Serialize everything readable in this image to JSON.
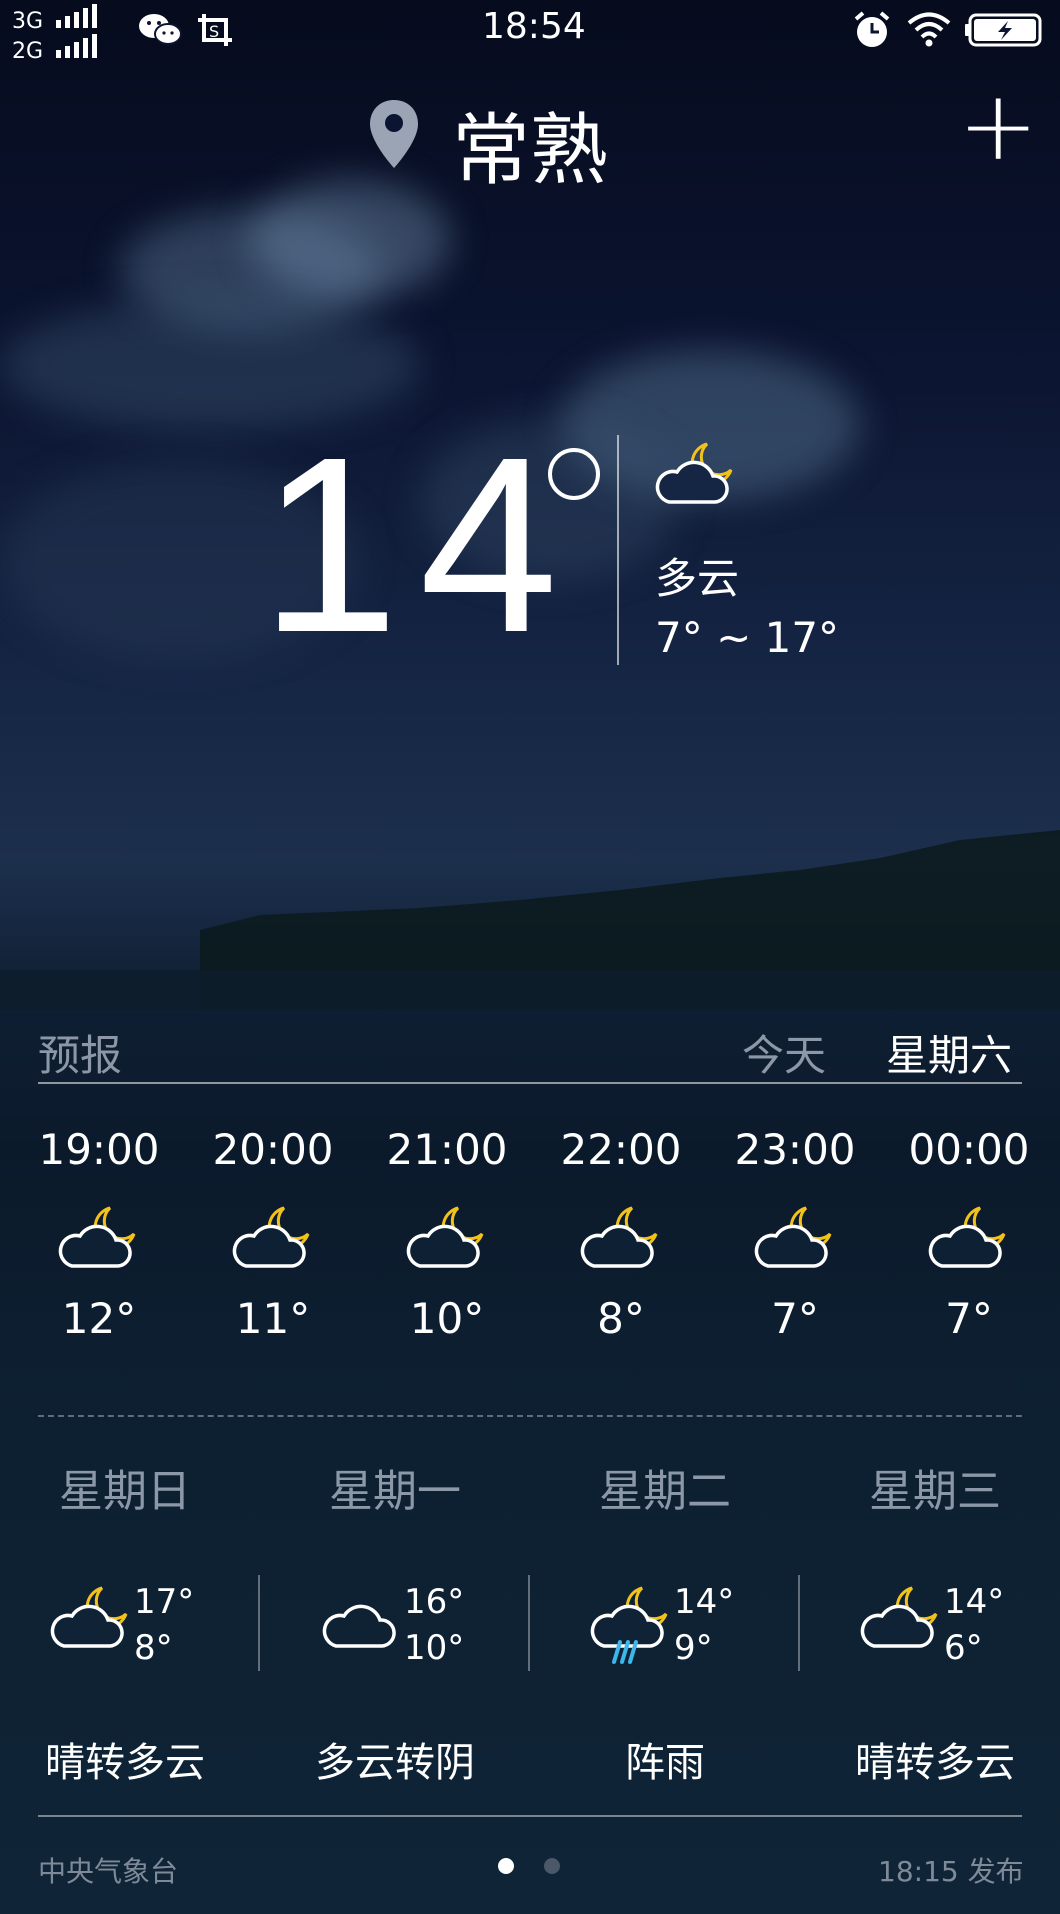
{
  "status_bar": {
    "network_1": "3G",
    "network_2": "2G",
    "time": "18:54",
    "icons": [
      "wechat-icon",
      "screenshot-icon",
      "alarm-icon",
      "wifi-icon",
      "battery-charging-icon"
    ]
  },
  "header": {
    "city": "常熟",
    "location_icon": "location-pin-icon",
    "add_icon": "plus-icon"
  },
  "current": {
    "temperature": "14",
    "condition": "多云",
    "range": "7° ~ 17°",
    "icon": "cloud-moon-icon"
  },
  "forecast": {
    "title": "预报",
    "tab_today": "今天",
    "tab_saturday": "星期六",
    "hourly": [
      {
        "time": "19:00",
        "temp": "12°",
        "icon": "cloud-moon-icon"
      },
      {
        "time": "20:00",
        "temp": "11°",
        "icon": "cloud-moon-icon"
      },
      {
        "time": "21:00",
        "temp": "10°",
        "icon": "cloud-moon-icon"
      },
      {
        "time": "22:00",
        "temp": "8°",
        "icon": "cloud-moon-icon"
      },
      {
        "time": "23:00",
        "temp": "7°",
        "icon": "cloud-moon-icon"
      },
      {
        "time": "00:00",
        "temp": "7°",
        "icon": "cloud-moon-icon"
      }
    ],
    "daily": [
      {
        "day": "星期日",
        "high": "17°",
        "low": "8°",
        "desc": "晴转多云",
        "icon": "cloud-moon-icon"
      },
      {
        "day": "星期一",
        "high": "16°",
        "low": "10°",
        "desc": "多云转阴",
        "icon": "cloud-icon"
      },
      {
        "day": "星期二",
        "high": "14°",
        "low": "9°",
        "desc": "阵雨",
        "icon": "rain-moon-icon"
      },
      {
        "day": "星期三",
        "high": "14°",
        "low": "6°",
        "desc": "晴转多云",
        "icon": "cloud-moon-icon"
      }
    ]
  },
  "footer": {
    "source": "中央气象台",
    "published": "18:15 发布",
    "page_count": 2,
    "current_page": 1
  },
  "colors": {
    "accent_moon": "#f2c21a",
    "rain": "#3db6ea",
    "muted_text": "#8c98a8"
  }
}
